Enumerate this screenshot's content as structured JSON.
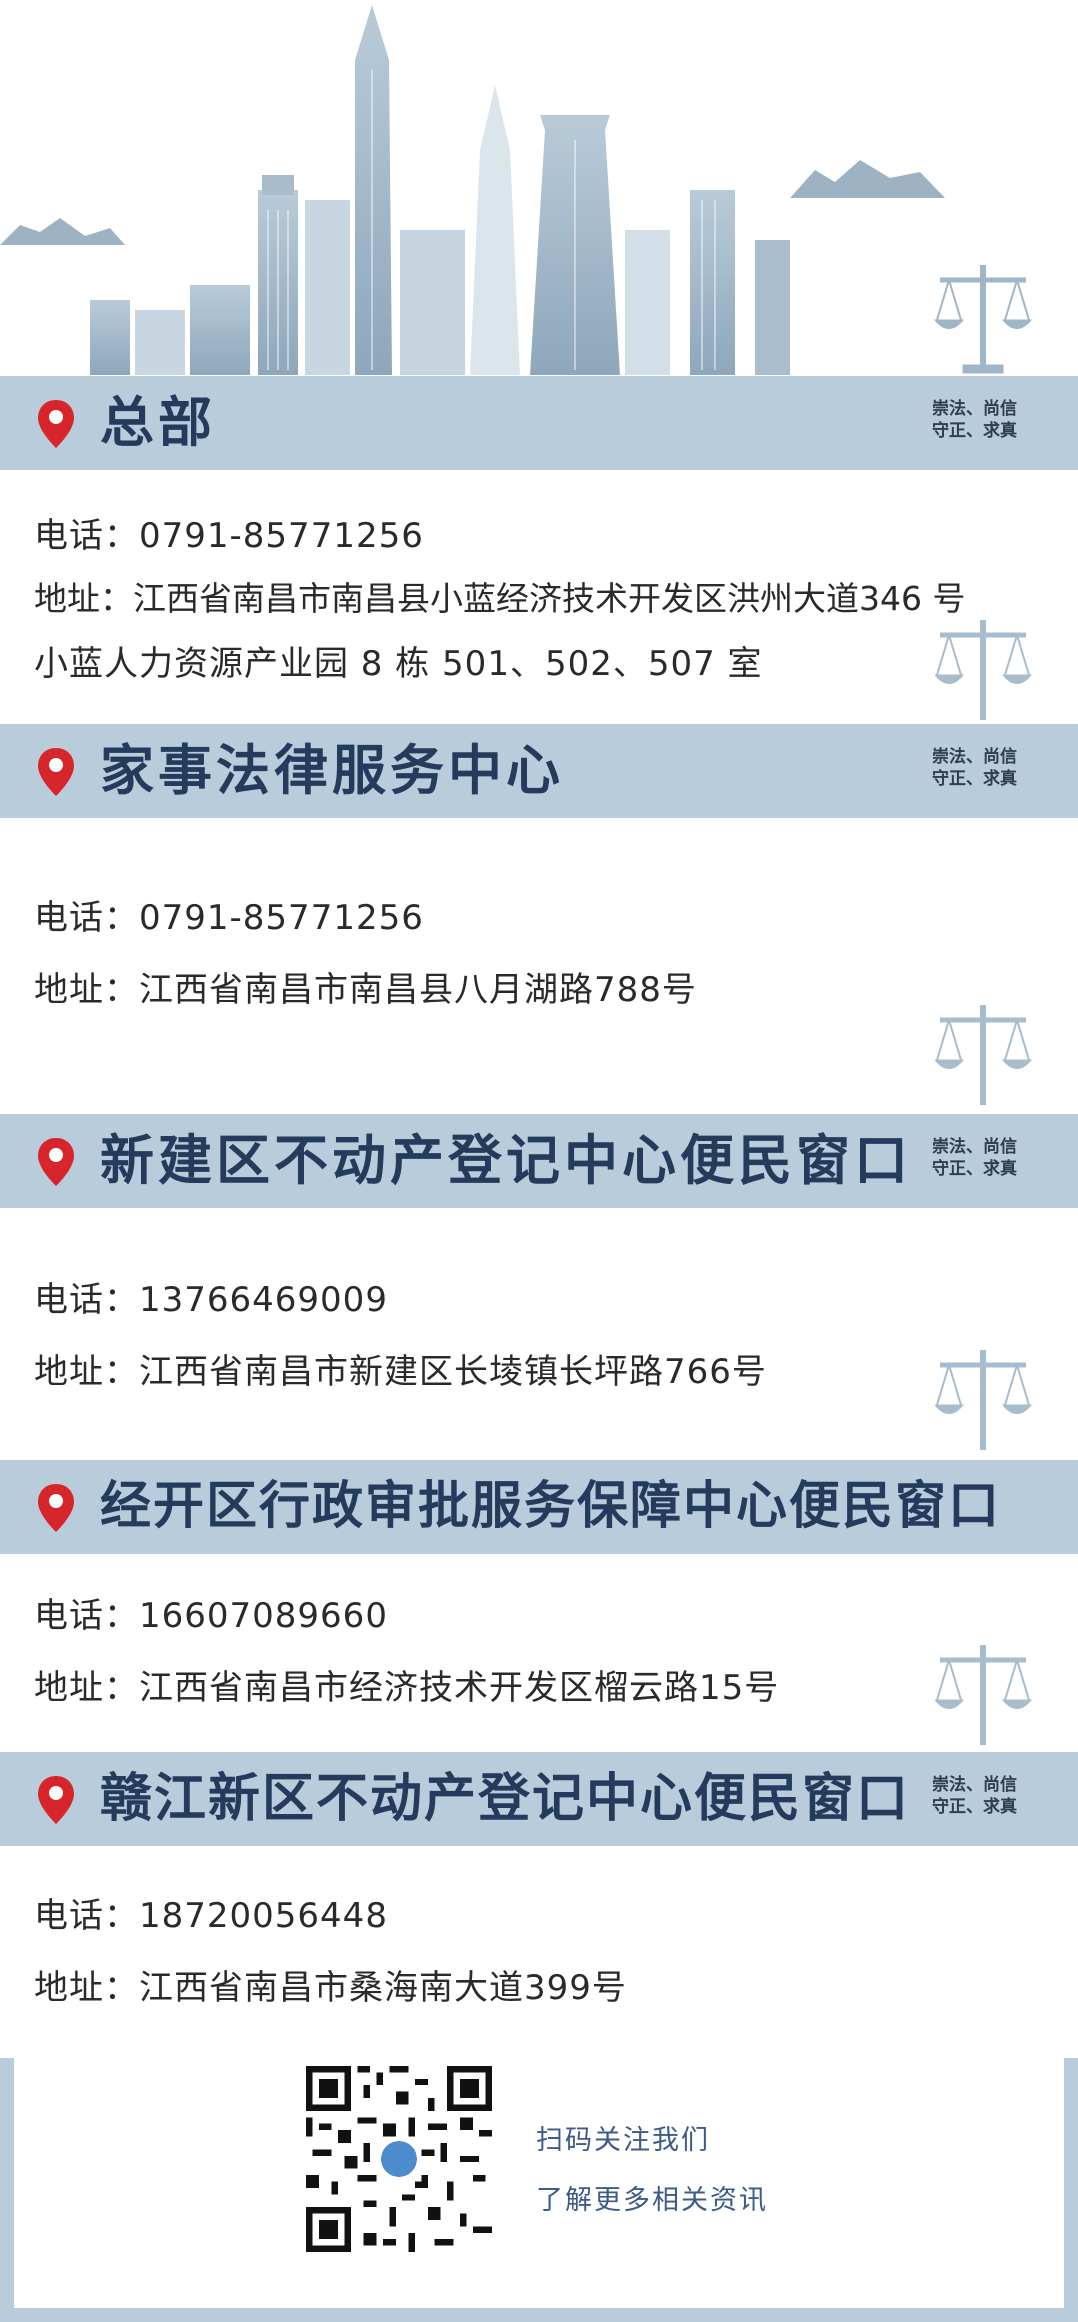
{
  "sections": [
    {
      "title": "总部",
      "motto_line1": "崇法、尚信",
      "motto_line2": "守正、求真",
      "lines": [
        "电话：0791-85771256",
        "地址：江西省南昌市南昌县小蓝经济技术开发区洪州大道346 号",
        "小蓝人力资源产业园 8 栋 501、502、507 室"
      ]
    },
    {
      "title": "家事法律服务中心",
      "motto_line1": "崇法、尚信",
      "motto_line2": "守正、求真",
      "lines": [
        "电话：0791-85771256",
        "地址：江西省南昌市南昌县八月湖路788号"
      ]
    },
    {
      "title": "新建区不动产登记中心便民窗口",
      "motto_line1": "崇法、尚信",
      "motto_line2": "守正、求真",
      "lines": [
        "电话：13766469009",
        "地址：江西省南昌市新建区长堎镇长坪路766号"
      ]
    },
    {
      "title": "经开区行政审批服务保障中心便民窗口",
      "lines": [
        "电话：16607089660",
        "地址：江西省南昌市经济技术开发区榴云路15号"
      ]
    },
    {
      "title": "赣江新区不动产登记中心便民窗口",
      "motto_line1": "崇法、尚信",
      "motto_line2": "守正、求真",
      "lines": [
        "电话：18720056448",
        "地址：江西省南昌市桑海南大道399号"
      ]
    }
  ],
  "footer": {
    "scan_text": "扫码关注我们",
    "more_text": "了解更多相关资讯"
  },
  "colors": {
    "bar": "#b8ccdb",
    "title": "#243b5c",
    "pin": "#d6262b",
    "skyline": "#9fb6c8"
  },
  "icons": [
    "location-pin-icon",
    "scales-of-justice-icon",
    "qr-code"
  ]
}
